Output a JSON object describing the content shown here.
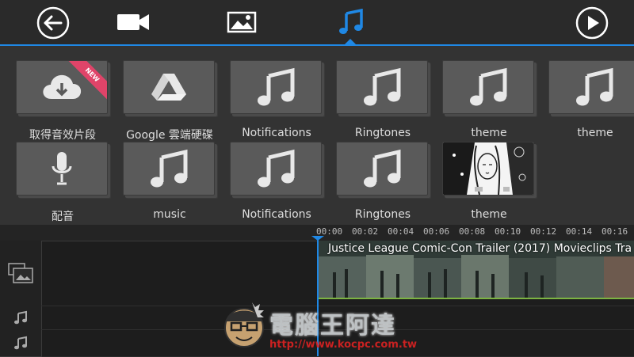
{
  "toolbar": {
    "back_icon": "arrow-left-circle-icon",
    "tabs": [
      {
        "name": "video",
        "icon": "video-camera-icon",
        "active": false
      },
      {
        "name": "photo",
        "icon": "image-icon",
        "active": false
      },
      {
        "name": "music",
        "icon": "music-note-icon",
        "active": true
      }
    ],
    "play_icon": "play-circle-icon",
    "accent_color": "#1f88e5"
  },
  "grid": {
    "row1": [
      {
        "label": "取得音效片段",
        "icon": "cloud-download-icon",
        "badge": "NEW"
      },
      {
        "label": "Google 雲端硬碟",
        "icon": "google-drive-icon"
      },
      {
        "label": "Notifications",
        "icon": "music-note-icon"
      },
      {
        "label": "Ringtones",
        "icon": "music-note-icon"
      },
      {
        "label": "theme",
        "icon": "music-note-icon"
      },
      {
        "label": "theme",
        "icon": "music-note-icon"
      }
    ],
    "row2": [
      {
        "label": "配音",
        "icon": "microphone-icon"
      },
      {
        "label": "music",
        "icon": "music-note-icon"
      },
      {
        "label": "Notifications",
        "icon": "music-note-icon"
      },
      {
        "label": "Ringtones",
        "icon": "music-note-icon"
      },
      {
        "label": "theme",
        "icon": "album-art-thumbnail"
      }
    ]
  },
  "timeline": {
    "ruler": [
      "00:00",
      "00:02",
      "00:04",
      "00:06",
      "00:08",
      "00:10",
      "00:12",
      "00:14",
      "00:16"
    ],
    "clip_title": "Justice League Comic-Con Trailer (2017)   Movieclips Tra",
    "tracks": [
      "video-track-icon",
      "audio-track-icon",
      "audio-track-icon"
    ]
  },
  "watermark": {
    "text": "電腦王阿達",
    "url": "http://www.kocpc.com.tw"
  }
}
